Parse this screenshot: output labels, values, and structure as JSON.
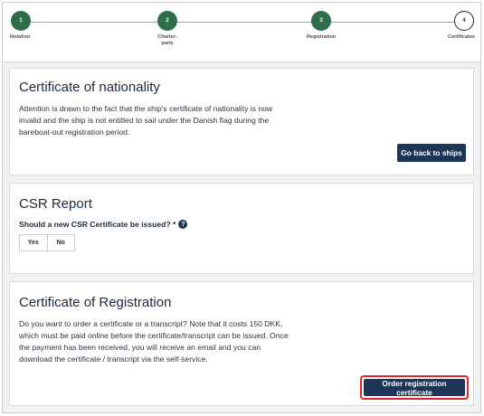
{
  "stepper": {
    "steps": [
      {
        "number": "1",
        "label": "Notation"
      },
      {
        "number": "2",
        "label": "Charter-\nparty"
      },
      {
        "number": "3",
        "label": "Registration"
      },
      {
        "number": "4",
        "label": "Certificates"
      }
    ]
  },
  "nationality": {
    "title": "Certificate of nationality",
    "text": "Attention is drawn to the fact that the ship's certificate of nationality is now invalid and the ship is not entitled to sail under the Danish flag during the bareboat-out registration period.",
    "button_label": "Go back to ships"
  },
  "csr": {
    "title": "CSR Report",
    "question": "Should a new CSR Certificate be issued? *",
    "help_icon": "?",
    "yes_label": "Yes",
    "no_label": "No"
  },
  "registration": {
    "title": "Certificate of Registration",
    "text": "Do you want to order a certificate or a transcript? Note that it costs 150 DKK, which must be paid online before the certificate/transcript can be issued. Once the payment has been received, you will receive an email and you can download the certificate / transcript via the self-service.",
    "button_label": "Order registration certificate"
  },
  "colors": {
    "step_done": "#2e6e4a",
    "primary_button": "#1d3557",
    "highlight": "#d8262c"
  }
}
